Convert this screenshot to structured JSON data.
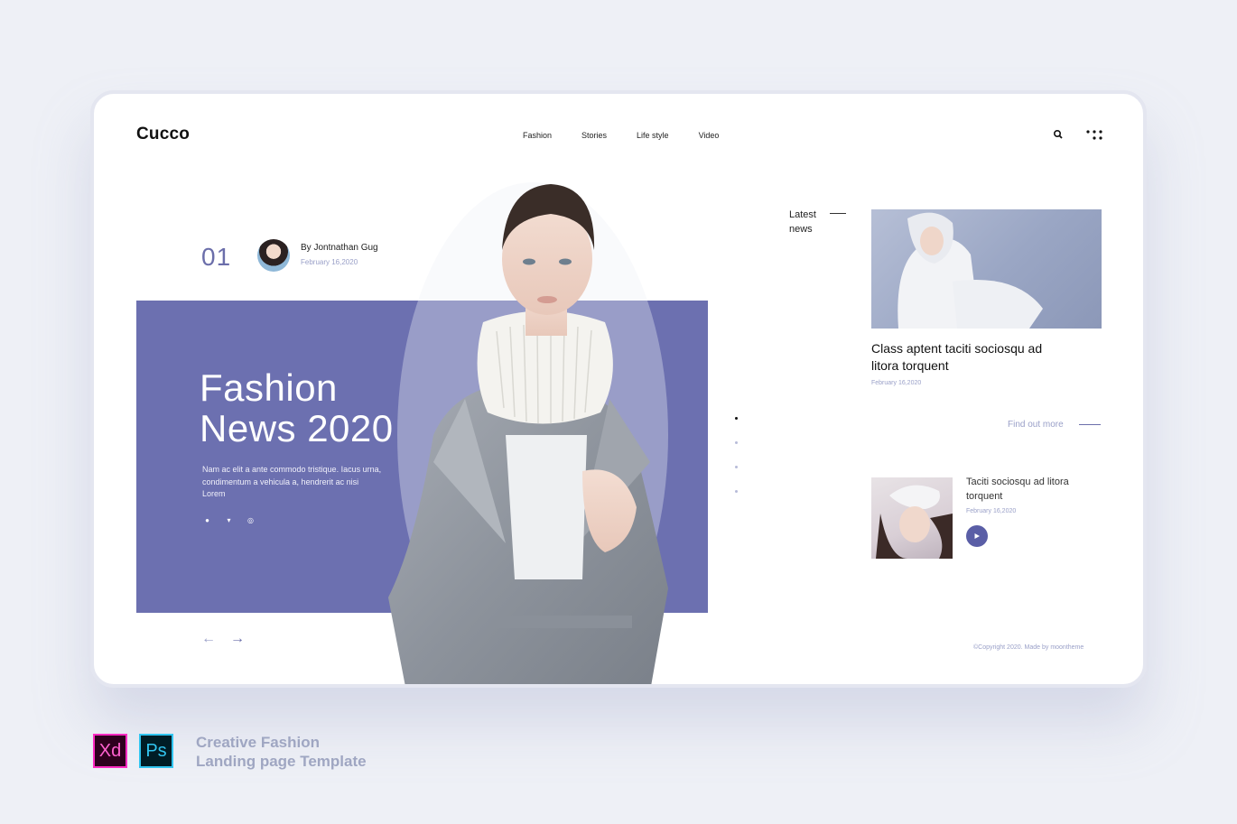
{
  "app": {
    "logo": "Cucco"
  },
  "nav": {
    "items": [
      "Fashion",
      "Stories",
      "Life style",
      "Video"
    ]
  },
  "hero": {
    "slide_number": "01",
    "author": "By Jontnathan Gug",
    "date": "February 16,2020",
    "title_line1": "Fashion",
    "title_line2": "News 2020",
    "description": "Nam ac elit a ante commodo tristique. Iacus urna, condimentum a vehicula a, hendrerit ac nisi Lorem",
    "panel_color": "#6c70b0"
  },
  "socials": [
    "facebook-icon",
    "twitter-icon",
    "instagram-icon"
  ],
  "slider": {
    "prev": "←",
    "next": "→"
  },
  "latest": {
    "label_line1": "Latest",
    "label_line2": "news",
    "news1": {
      "title": "Class aptent taciti sociosqu ad litora torquent",
      "date": "February 16,2020"
    },
    "find_more": "Find out more",
    "news2": {
      "title": "Taciti sociosqu ad litora torquent",
      "date": "February 16,2020"
    }
  },
  "footer": {
    "copyright": "©Copyright 2020. Made by moontheme"
  },
  "caption": {
    "line1": "Creative Fashion",
    "line2": "Landing page Template"
  },
  "badges": {
    "xd": "Xd",
    "ps": "Ps"
  }
}
